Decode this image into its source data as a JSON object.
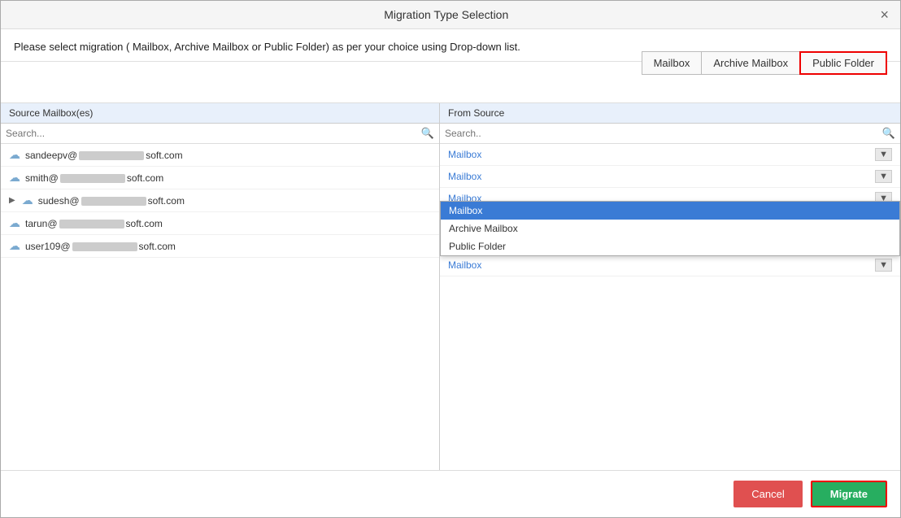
{
  "dialog": {
    "title": "Migration Type Selection",
    "instruction": "Please select migration ( Mailbox, Archive Mailbox or Public Folder) as per your choice using Drop-down list.",
    "close_label": "×"
  },
  "type_buttons": [
    {
      "id": "mailbox",
      "label": "Mailbox",
      "active": false
    },
    {
      "id": "archive-mailbox",
      "label": "Archive Mailbox",
      "active": false
    },
    {
      "id": "public-folder",
      "label": "Public Folder",
      "active": true
    }
  ],
  "left_panel": {
    "header": "Source Mailbox(es)",
    "search_placeholder": "Search...",
    "rows": [
      {
        "name_prefix": "sandeepv@",
        "name_suffix": "soft.com",
        "has_arrow": false
      },
      {
        "name_prefix": "smith@",
        "name_suffix": "soft.com",
        "has_arrow": false
      },
      {
        "name_prefix": "sudesh@",
        "name_suffix": "soft.com",
        "has_arrow": true
      },
      {
        "name_prefix": "tarun@",
        "name_suffix": "soft.com",
        "has_arrow": false
      },
      {
        "name_prefix": "user109@",
        "name_suffix": "soft.com",
        "has_arrow": false
      }
    ]
  },
  "right_panel": {
    "header": "From Source",
    "search_placeholder": "Search..",
    "rows": [
      {
        "value": "Mailbox",
        "open": false
      },
      {
        "value": "Mailbox",
        "open": false
      },
      {
        "value": "Mailbox",
        "open": true
      },
      {
        "value": "Mailbox",
        "open": false
      }
    ],
    "dropdown_options": [
      {
        "label": "Mailbox",
        "selected": true
      },
      {
        "label": "Archive Mailbox",
        "selected": false
      },
      {
        "label": "Public Folder",
        "selected": false
      }
    ]
  },
  "footer": {
    "cancel_label": "Cancel",
    "migrate_label": "Migrate"
  }
}
